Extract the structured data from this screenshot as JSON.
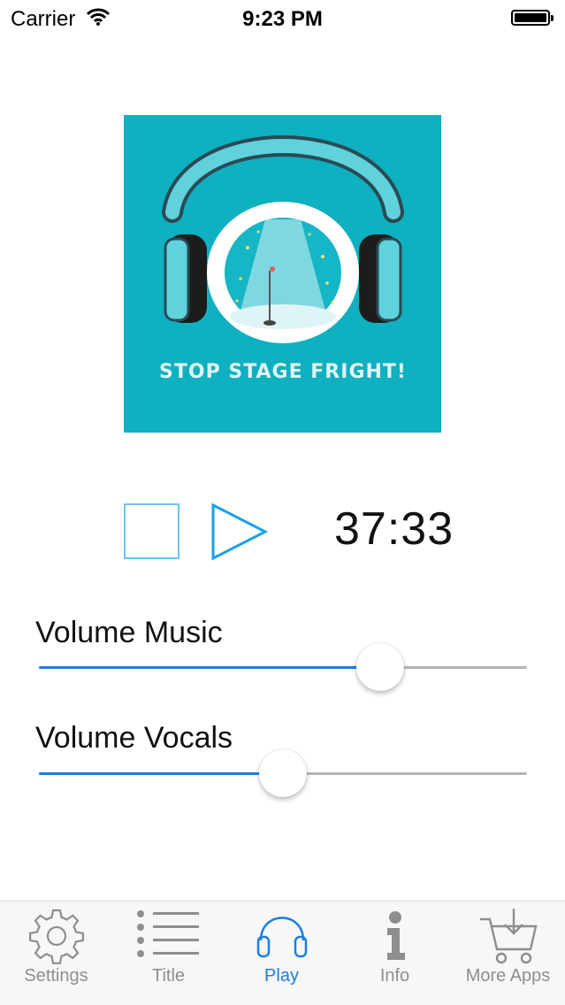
{
  "status_bar": {
    "carrier": "Carrier",
    "time": "9:23 PM"
  },
  "artwork": {
    "caption": "STOP STAGE FRIGHT!",
    "background": "#0fb0bf"
  },
  "player": {
    "time_remaining": "37:33"
  },
  "sliders": [
    {
      "label": "Volume Music",
      "value": 0.7
    },
    {
      "label": "Volume Vocals",
      "value": 0.5
    }
  ],
  "tabs": [
    {
      "label": "Settings",
      "icon": "gear-icon",
      "active": false
    },
    {
      "label": "Title",
      "icon": "list-icon",
      "active": false
    },
    {
      "label": "Play",
      "icon": "headphones-icon",
      "active": true
    },
    {
      "label": "Info",
      "icon": "info-icon",
      "active": false
    },
    {
      "label": "More Apps",
      "icon": "cart-icon",
      "active": false
    }
  ],
  "colors": {
    "accent": "#1a7fe2",
    "inactive": "#8e8e8e",
    "control_outline": "#6cc6ee"
  }
}
